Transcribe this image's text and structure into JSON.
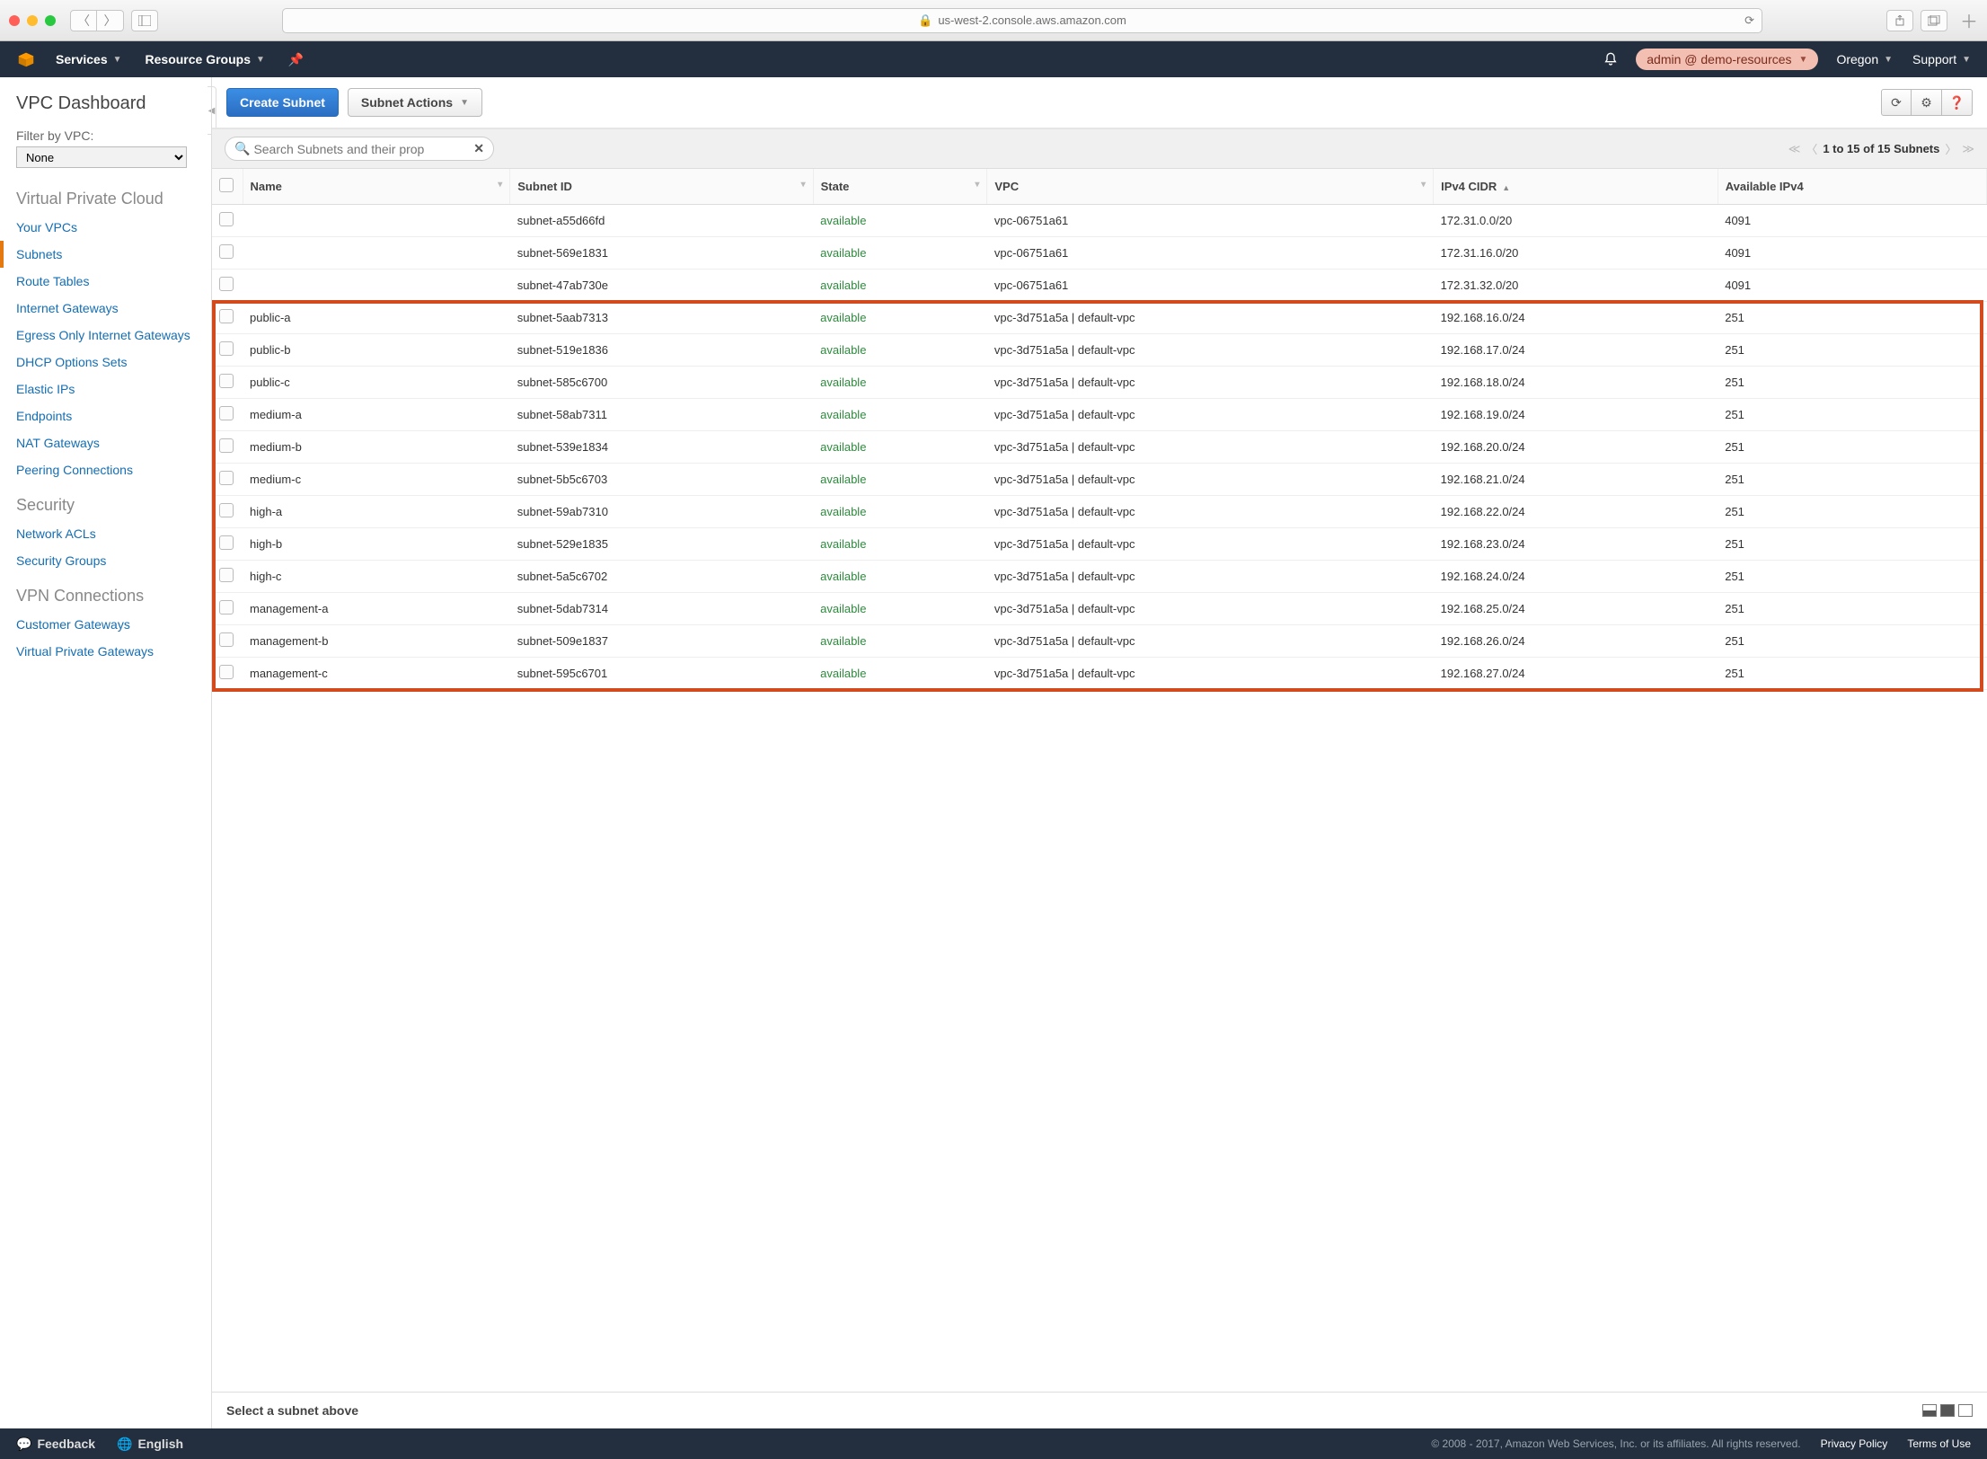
{
  "browser": {
    "url": "us-west-2.console.aws.amazon.com"
  },
  "nav": {
    "services": "Services",
    "resource_groups": "Resource Groups",
    "account": "admin @ demo-resources",
    "region": "Oregon",
    "support": "Support"
  },
  "sidebar": {
    "title": "VPC Dashboard",
    "filter_label": "Filter by VPC:",
    "filter_value": "None",
    "group_vpc": "Virtual Private Cloud",
    "links_vpc": [
      "Your VPCs",
      "Subnets",
      "Route Tables",
      "Internet Gateways",
      "Egress Only Internet Gateways",
      "DHCP Options Sets",
      "Elastic IPs",
      "Endpoints",
      "NAT Gateways",
      "Peering Connections"
    ],
    "group_sec": "Security",
    "links_sec": [
      "Network ACLs",
      "Security Groups"
    ],
    "group_vpn": "VPN Connections",
    "links_vpn": [
      "Customer Gateways",
      "Virtual Private Gateways"
    ]
  },
  "toolbar": {
    "create": "Create Subnet",
    "actions": "Subnet Actions"
  },
  "search": {
    "placeholder": "Search Subnets and their prop",
    "pager_text": "1 to 15 of 15 Subnets"
  },
  "table": {
    "cols": [
      "Name",
      "Subnet ID",
      "State",
      "VPC",
      "IPv4 CIDR",
      "Available IPv4"
    ],
    "rows": [
      {
        "name": "",
        "subnet": "subnet-a55d66fd",
        "state": "available",
        "vpc": "vpc-06751a61",
        "cidr": "172.31.0.0/20",
        "avail": "4091",
        "hl": false
      },
      {
        "name": "",
        "subnet": "subnet-569e1831",
        "state": "available",
        "vpc": "vpc-06751a61",
        "cidr": "172.31.16.0/20",
        "avail": "4091",
        "hl": false
      },
      {
        "name": "",
        "subnet": "subnet-47ab730e",
        "state": "available",
        "vpc": "vpc-06751a61",
        "cidr": "172.31.32.0/20",
        "avail": "4091",
        "hl": false
      },
      {
        "name": "public-a",
        "subnet": "subnet-5aab7313",
        "state": "available",
        "vpc": "vpc-3d751a5a | default-vpc",
        "cidr": "192.168.16.0/24",
        "avail": "251",
        "hl": true
      },
      {
        "name": "public-b",
        "subnet": "subnet-519e1836",
        "state": "available",
        "vpc": "vpc-3d751a5a | default-vpc",
        "cidr": "192.168.17.0/24",
        "avail": "251",
        "hl": true
      },
      {
        "name": "public-c",
        "subnet": "subnet-585c6700",
        "state": "available",
        "vpc": "vpc-3d751a5a | default-vpc",
        "cidr": "192.168.18.0/24",
        "avail": "251",
        "hl": true
      },
      {
        "name": "medium-a",
        "subnet": "subnet-58ab7311",
        "state": "available",
        "vpc": "vpc-3d751a5a | default-vpc",
        "cidr": "192.168.19.0/24",
        "avail": "251",
        "hl": true
      },
      {
        "name": "medium-b",
        "subnet": "subnet-539e1834",
        "state": "available",
        "vpc": "vpc-3d751a5a | default-vpc",
        "cidr": "192.168.20.0/24",
        "avail": "251",
        "hl": true
      },
      {
        "name": "medium-c",
        "subnet": "subnet-5b5c6703",
        "state": "available",
        "vpc": "vpc-3d751a5a | default-vpc",
        "cidr": "192.168.21.0/24",
        "avail": "251",
        "hl": true
      },
      {
        "name": "high-a",
        "subnet": "subnet-59ab7310",
        "state": "available",
        "vpc": "vpc-3d751a5a | default-vpc",
        "cidr": "192.168.22.0/24",
        "avail": "251",
        "hl": true
      },
      {
        "name": "high-b",
        "subnet": "subnet-529e1835",
        "state": "available",
        "vpc": "vpc-3d751a5a | default-vpc",
        "cidr": "192.168.23.0/24",
        "avail": "251",
        "hl": true
      },
      {
        "name": "high-c",
        "subnet": "subnet-5a5c6702",
        "state": "available",
        "vpc": "vpc-3d751a5a | default-vpc",
        "cidr": "192.168.24.0/24",
        "avail": "251",
        "hl": true
      },
      {
        "name": "management-a",
        "subnet": "subnet-5dab7314",
        "state": "available",
        "vpc": "vpc-3d751a5a | default-vpc",
        "cidr": "192.168.25.0/24",
        "avail": "251",
        "hl": true
      },
      {
        "name": "management-b",
        "subnet": "subnet-509e1837",
        "state": "available",
        "vpc": "vpc-3d751a5a | default-vpc",
        "cidr": "192.168.26.0/24",
        "avail": "251",
        "hl": true
      },
      {
        "name": "management-c",
        "subnet": "subnet-595c6701",
        "state": "available",
        "vpc": "vpc-3d751a5a | default-vpc",
        "cidr": "192.168.27.0/24",
        "avail": "251",
        "hl": true
      }
    ]
  },
  "detail": {
    "empty": "Select a subnet above"
  },
  "footer": {
    "feedback": "Feedback",
    "language": "English",
    "copy": "© 2008 - 2017, Amazon Web Services, Inc. or its affiliates. All rights reserved.",
    "privacy": "Privacy Policy",
    "terms": "Terms of Use"
  }
}
